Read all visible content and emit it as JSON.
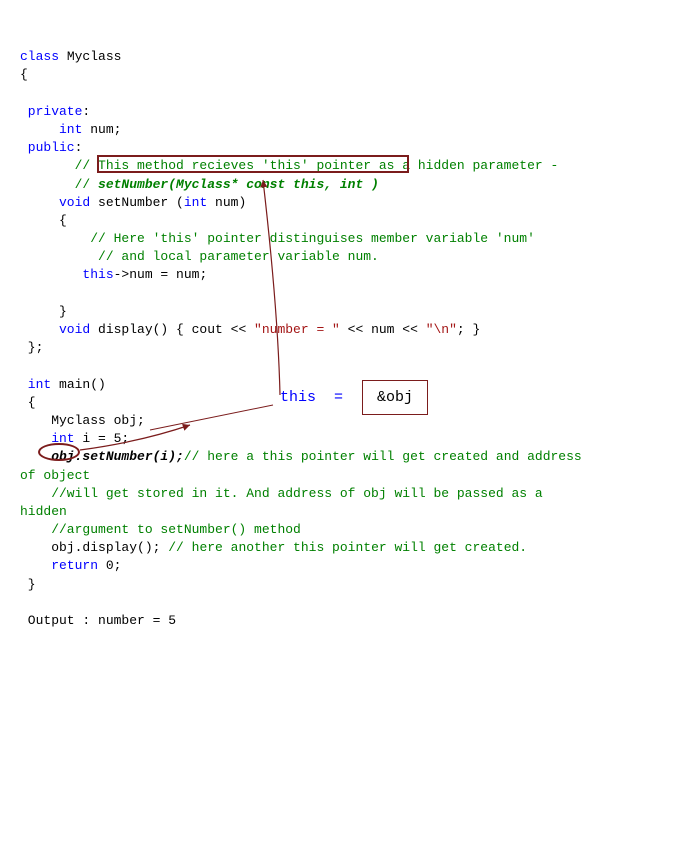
{
  "code": {
    "l1a": "class",
    "l1b": " Myclass",
    "l2": "{",
    "l3": "",
    "l4a": " private",
    "l4b": ":",
    "l5a": "     int",
    "l5b": " num;",
    "l6a": " public",
    "l6b": ":",
    "l7a": "       // This method recieves 'this' pointer as a hidden parameter -",
    "l8a": "       // ",
    "l8b": "setNumber(Myclass* const this, int )",
    "l9a": "     void",
    "l9b": " setNumber (",
    "l9c": "int",
    "l9d": " num)",
    "l10": "     {",
    "l11a": "         // Here 'this' pointer distinguises member variable 'num'",
    "l12a": "          // and local parameter variable num.",
    "l13a": "        this",
    "l13b": "->num = num;",
    "l14": "",
    "l15": "     }",
    "l16a": "     void",
    "l16b": " display() { cout << ",
    "l16c": "\"number = \"",
    "l16d": " << num << ",
    "l16e": "\"\\n\"",
    "l16f": "; }",
    "l17": " };",
    "l18": "",
    "l19a": " int",
    "l19b": " main()",
    "l20": " {",
    "l21": "    Myclass obj;",
    "l22a": "    int",
    "l22b": " i = 5;",
    "l23a": "    obj.",
    "l23b": "setNumber(i);",
    "l23c": "// here a this pointer will get created and address",
    "l24a": "of object",
    "l25a": "    //will get stored in it. And address of obj will be passed as a",
    "l26a": "hidden",
    "l27a": "    //argument to setNumber() method",
    "l28a": "    obj.display(); ",
    "l28b": "// here another this pointer will get created.",
    "l29a": "    return",
    "l29b": " 0;",
    "l30": " }",
    "l31": "",
    "out": " Output : number = 5"
  },
  "annotations": {
    "this_label": "this  =",
    "obj_box": "&obj"
  }
}
